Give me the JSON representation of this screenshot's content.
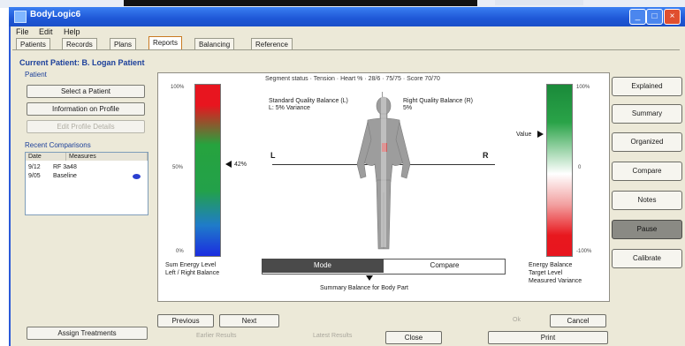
{
  "window": {
    "title": "BodyLogic6",
    "min_glyph": "_",
    "max_glyph": "□",
    "close_glyph": "×"
  },
  "menu": [
    "File",
    "Edit",
    "Help"
  ],
  "tabs": [
    "Patients",
    "Records",
    "Plans",
    "Reports",
    "Balancing",
    "Reference"
  ],
  "active_tab_index": 3,
  "current_patient": "Current Patient: B. Logan Patient",
  "left_panel": {
    "group1_label": "Patient",
    "buttons": [
      {
        "label": "Select a Patient",
        "enabled": true
      },
      {
        "label": "Information on Profile",
        "enabled": true
      },
      {
        "label": "Edit Profile Details",
        "enabled": false
      }
    ],
    "group2_label": "Recent Comparisons",
    "table_headers": [
      "Date",
      "Measures"
    ],
    "table_rows": [
      {
        "date": "9/12",
        "value": "RF 3a48"
      },
      {
        "date": "9/05",
        "value": "Baseline"
      }
    ],
    "bottom_button": "Assign Treatments"
  },
  "main_panel": {
    "caption": "Segment status · Tension · Heart % · 28/6 · 75/75 · Score 70/70",
    "left_scale": {
      "top_label": "100%",
      "mid_label": "50%",
      "bottom_label": "0%",
      "value_label": "42%",
      "value": 0.45,
      "caption": "Sum Energy Level\nLeft / Right Balance"
    },
    "right_scale": {
      "top_label": "100%",
      "mid_label": "0",
      "bottom_label": "-100%",
      "value_label": "Value",
      "value": 0.3,
      "caption": "Energy Balance\nTarget Level\nMeasured Variance"
    },
    "legend_left": [
      "Standard Quality Balance (L)",
      "L: 5% Variance"
    ],
    "legend_right": [
      "Right Quality Balance (R)",
      "5%"
    ],
    "side_left": "L",
    "side_right": "R",
    "toggle_left": "Mode",
    "toggle_right": "Compare",
    "toggle_caption": "Summary Balance for Body Part"
  },
  "right_buttons": [
    {
      "label": "Explained",
      "dark": false
    },
    {
      "label": "Summary",
      "dark": false
    },
    {
      "label": "Organized",
      "dark": false
    },
    {
      "label": "Compare",
      "dark": false
    },
    {
      "label": "Notes",
      "dark": false
    },
    {
      "label": "Pause",
      "dark": true
    },
    {
      "label": "Calibrate",
      "dark": false
    }
  ],
  "bottom": {
    "btn_previous": "Previous",
    "btn_next": "Next",
    "hint_left": "Earlier Results",
    "hint_mid": "Latest Results",
    "hint_ok": "Ok",
    "btn_cancel": "Cancel",
    "btn_close": "Close",
    "btn_print": "Print"
  },
  "colors": {
    "title_bar": "#1e57d6",
    "window_face": "#ece9d8",
    "group_label": "#1b3f9a",
    "active_tab_border": "#c97a22"
  }
}
